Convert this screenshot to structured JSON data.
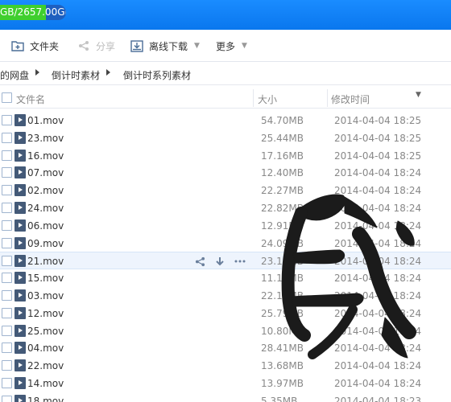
{
  "storage": {
    "quota_text": "GB/2657.00GB",
    "used_fraction": 0.7
  },
  "toolbar": {
    "new_folder": "文件夹",
    "share": "分享",
    "offline_download": "离线下载",
    "more": "更多"
  },
  "breadcrumb": [
    "的网盘",
    "倒计时素材",
    "倒计时系列素材"
  ],
  "columns": {
    "name": "文件名",
    "size": "大小",
    "modified": "修改时间"
  },
  "files": [
    {
      "name": "01.mov",
      "size": "54.70MB",
      "modified": "2014-04-04 18:25"
    },
    {
      "name": "23.mov",
      "size": "25.44MB",
      "modified": "2014-04-04 18:25"
    },
    {
      "name": "16.mov",
      "size": "17.16MB",
      "modified": "2014-04-04 18:25"
    },
    {
      "name": "07.mov",
      "size": "12.40MB",
      "modified": "2014-04-04 18:24"
    },
    {
      "name": "02.mov",
      "size": "22.27MB",
      "modified": "2014-04-04 18:24"
    },
    {
      "name": "24.mov",
      "size": "22.82MB",
      "modified": "2014-04-04 18:24"
    },
    {
      "name": "06.mov",
      "size": "12.91MB",
      "modified": "2014-04-04 18:24"
    },
    {
      "name": "09.mov",
      "size": "24.09MB",
      "modified": "2014-04-04 18:24"
    },
    {
      "name": "21.mov",
      "size": "23.10MB",
      "modified": "2014-04-04 18:24"
    },
    {
      "name": "15.mov",
      "size": "11.13MB",
      "modified": "2014-04-04 18:24"
    },
    {
      "name": "03.mov",
      "size": "22.10MB",
      "modified": "2014-04-04 18:24"
    },
    {
      "name": "12.mov",
      "size": "25.79MB",
      "modified": "2014-04-04 18:24"
    },
    {
      "name": "25.mov",
      "size": "10.80MB",
      "modified": "2014-04-04 18:24"
    },
    {
      "name": "04.mov",
      "size": "28.41MB",
      "modified": "2014-04-04 18:24"
    },
    {
      "name": "22.mov",
      "size": "13.68MB",
      "modified": "2014-04-04 18:24"
    },
    {
      "name": "14.mov",
      "size": "13.97MB",
      "modified": "2014-04-04 18:24"
    },
    {
      "name": "18.mov",
      "size": "5.35MB",
      "modified": "2014-04-04 18:23"
    }
  ],
  "highlighted_row": 8,
  "overlay": {
    "glyph": "民"
  },
  "colors": {
    "accent": "#0a77ee",
    "quota_fill": "#3fcf2e",
    "row_highlight": "#eef4fd"
  }
}
